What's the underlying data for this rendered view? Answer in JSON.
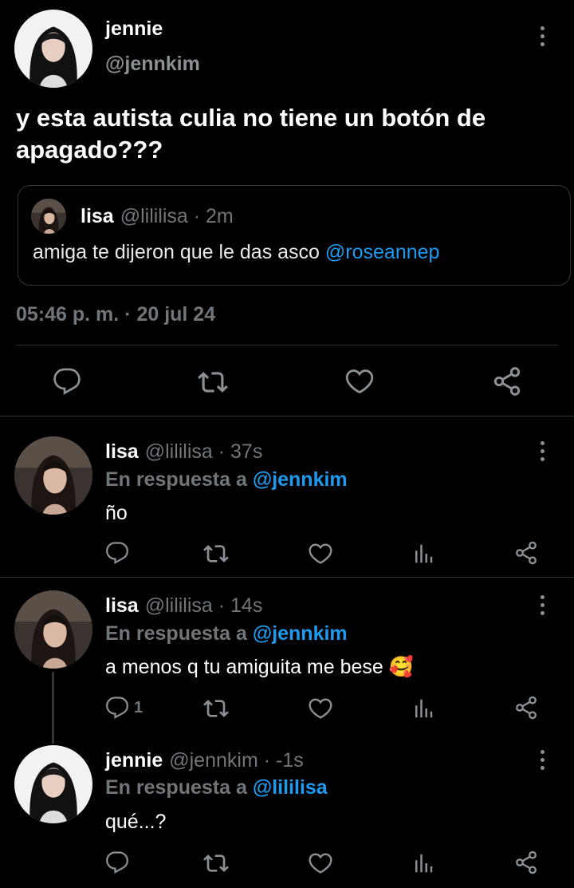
{
  "main_tweet": {
    "author_name": "jennie",
    "author_handle": "@jennkim",
    "text": "y esta autista culia no tiene un botón de apagado???",
    "quote": {
      "author_name": "lisa",
      "author_handle": "@lililisa",
      "separator": " · ",
      "time": "2m",
      "text": "amiga te dijeron que le das asco ",
      "mention": "@roseannep"
    },
    "timestamp": "05:46 p. m. · 20 jul 24"
  },
  "replies": [
    {
      "author_name": "lisa",
      "author_handle": "@lililisa",
      "separator": " · ",
      "time": "37s",
      "reply_prefix": "En respuesta a ",
      "reply_to": "@jennkim",
      "text": "ño",
      "reply_count": ""
    },
    {
      "author_name": "lisa",
      "author_handle": "@lililisa",
      "separator": " · ",
      "time": "14s",
      "reply_prefix": "En respuesta a ",
      "reply_to": "@jennkim",
      "text": "a menos q tu amiguita me bese ",
      "emoji": "🥰",
      "reply_count": "1"
    },
    {
      "author_name": "jennie",
      "author_handle": "@jennkim",
      "separator": " · ",
      "time": "-1s",
      "reply_prefix": "En respuesta a ",
      "reply_to": "@lililisa",
      "text": "qué...?",
      "reply_count": ""
    }
  ],
  "icons": [
    "reply-icon",
    "retweet-icon",
    "like-icon",
    "views-icon",
    "share-icon",
    "more-icon"
  ],
  "colors": {
    "background": "#000000",
    "text": "#e7e9ea",
    "muted": "#71767b",
    "link": "#1d9bf0",
    "border": "#2f3336"
  }
}
